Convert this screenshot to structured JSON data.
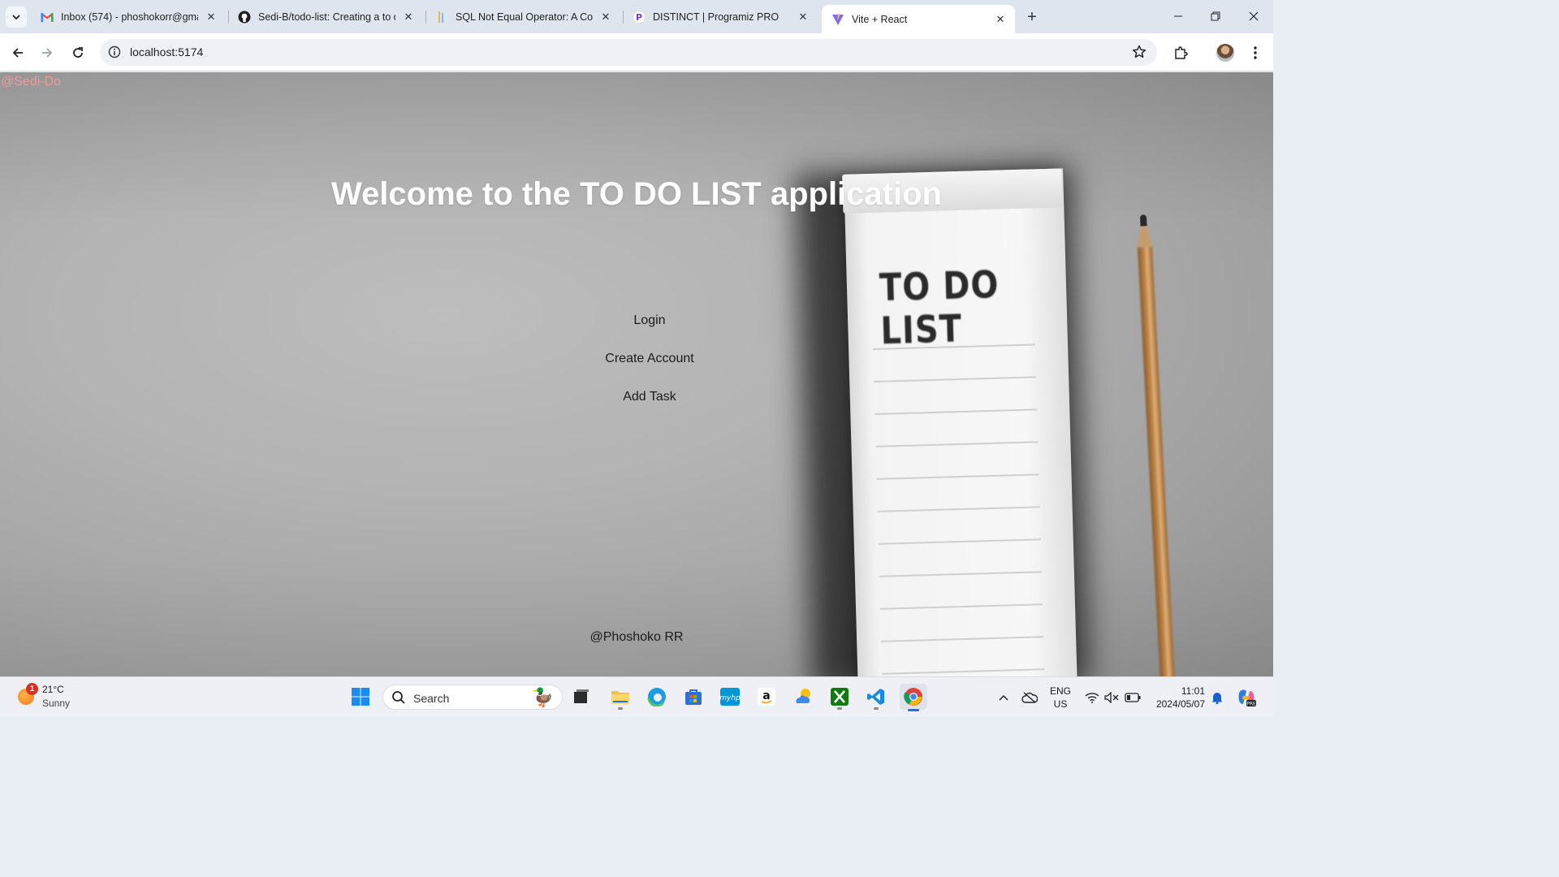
{
  "browser": {
    "tabs": [
      {
        "title": "Inbox (574) - phoshokorr@gma",
        "icon": "gmail-icon"
      },
      {
        "title": "Sedi-B/todo-list: Creating a to d",
        "icon": "github-icon"
      },
      {
        "title": "SQL Not Equal Operator: A Com",
        "icon": "sql-icon"
      },
      {
        "title": "DISTINCT | Programiz PRO",
        "icon": "programiz-icon"
      },
      {
        "title": "Vite + React",
        "icon": "vite-icon",
        "active": true
      }
    ],
    "url": "localhost:5174"
  },
  "page": {
    "handle": "@Sedi-Do",
    "welcome": "Welcome to the TO DO LIST application",
    "background_text": "TO DO LIST",
    "menu": [
      "Login",
      "Create Account",
      "Add Task"
    ],
    "footer": "@Phoshoko RR",
    "colors": {
      "handle": "#ec9b9b",
      "heading": "#ffffff"
    }
  },
  "taskbar": {
    "weather": {
      "badge": "1",
      "temp": "21°C",
      "condition": "Sunny"
    },
    "search": "Search",
    "lang": {
      "line1": "ENG",
      "line2": "US"
    },
    "clock": {
      "time": "11:01",
      "date": "2024/05/07"
    }
  }
}
